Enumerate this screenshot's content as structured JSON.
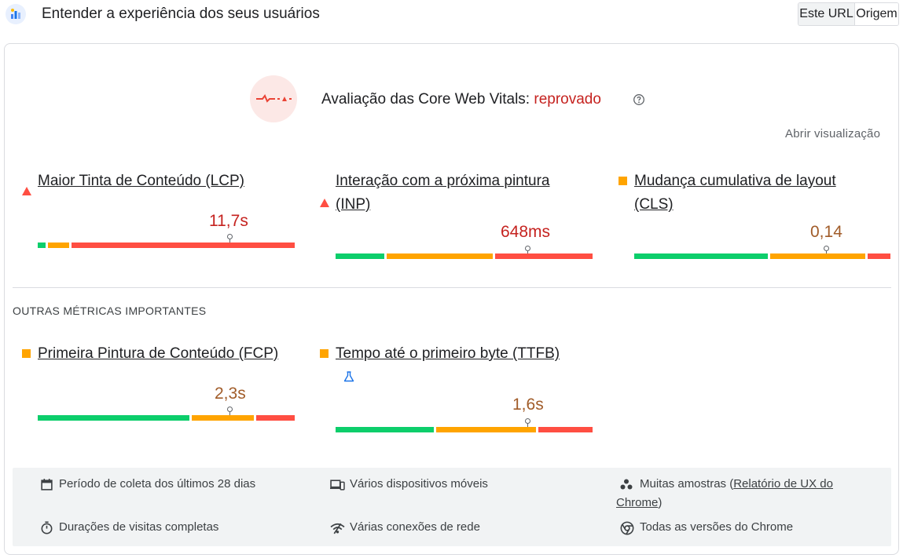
{
  "header": {
    "title": "Entender a experiência dos seus usuários",
    "toggle": {
      "this_url": "Este URL",
      "origin": "Origem",
      "active": "this_url"
    }
  },
  "assessment": {
    "label": "Avaliação das Core Web Vitals:",
    "status": "reprovado",
    "open_view": "Abrir visualização"
  },
  "core_metrics": [
    {
      "name": "Maior Tinta de Conteúdo (LCP)",
      "value": "11,7s",
      "rating": "poor",
      "icon": "triangle-red-icon"
    },
    {
      "name": "Interação com a próxima pintura (INP)",
      "value": "648ms",
      "rating": "poor",
      "icon": "triangle-red-icon"
    },
    {
      "name": "Mudança cumulativa de layout (CLS)",
      "value": "0,14",
      "rating": "needs-improvement",
      "icon": "square-orange-icon"
    }
  ],
  "other_metrics": {
    "title": "OUTRAS MÉTRICAS IMPORTANTES",
    "items": [
      {
        "name": "Primeira Pintura de Conteúdo (FCP)",
        "value": "2,3s",
        "rating": "needs-improvement",
        "icon": "square-orange-icon"
      },
      {
        "name": "Tempo até o primeiro byte (TTFB)",
        "value": "1,6s",
        "rating": "needs-improvement",
        "icon": "square-orange-icon",
        "extra_icon": "experimental-flask-icon"
      }
    ]
  },
  "distribution_bars": {
    "lcp": {
      "good": 0.04,
      "needs_improvement": 0.09,
      "poor": 0.87,
      "marker": 0.75
    },
    "inp": {
      "good": 0.2,
      "needs_improvement": 0.42,
      "poor": 0.38,
      "marker": 0.75
    },
    "cls": {
      "good": 0.53,
      "needs_improvement": 0.38,
      "poor": 0.09,
      "marker": 0.75
    },
    "fcp": {
      "good": 0.6,
      "needs_improvement": 0.25,
      "poor": 0.15,
      "marker": 0.75
    },
    "ttfb": {
      "good": 0.39,
      "needs_improvement": 0.4,
      "poor": 0.21,
      "marker": 0.75
    }
  },
  "footer": {
    "collection_period": "Período de coleta dos últimos 28 dias",
    "devices": "Vários dispositivos móveis",
    "samples_prefix": "Muitas amostras (",
    "samples_link": "Relatório de UX do Chrome",
    "samples_suffix": ")",
    "visit_durations": "Durações de visitas completas",
    "network": "Várias conexões de rede",
    "chrome_versions": "Todas as versões do Chrome"
  },
  "colors": {
    "good": "#0cce6b",
    "needs_improvement": "#ffa400",
    "poor": "#ff4e42",
    "fail_text": "#c5221f",
    "ni_text": "#a15c29"
  }
}
